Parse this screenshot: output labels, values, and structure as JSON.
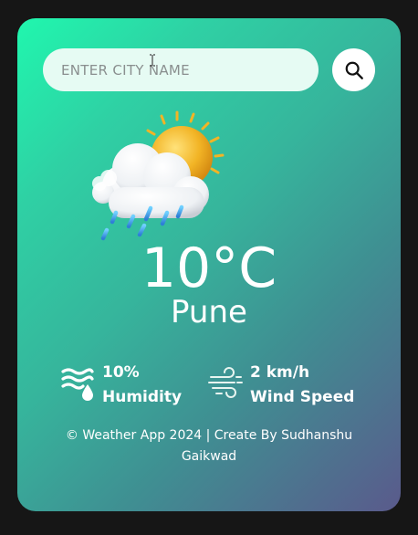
{
  "search": {
    "placeholder": "ENTER CITY NAME",
    "button_icon": "search-icon"
  },
  "weather": {
    "condition_icon": "cloud-sun-rain-icon",
    "temperature": "10°C",
    "city": "Pune"
  },
  "details": {
    "humidity": {
      "value": "10%",
      "label": "Humidity",
      "icon": "humidity-icon"
    },
    "wind": {
      "value": "2 km/h",
      "label": "Wind Speed",
      "icon": "wind-icon"
    }
  },
  "footer": {
    "text": "© Weather App 2024 | Create By Sudhanshu Gaikwad"
  },
  "colors": {
    "gradient_start": "#20f7ae",
    "gradient_end": "#5a5a8c",
    "input_bg": "#e6fbf3",
    "text": "#ffffff"
  }
}
